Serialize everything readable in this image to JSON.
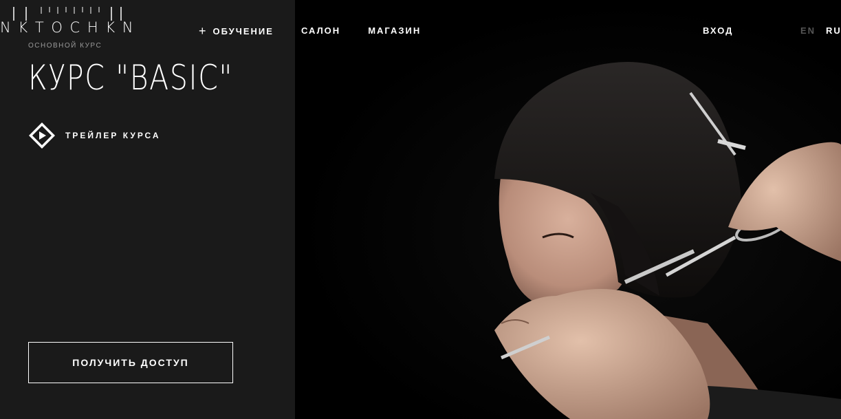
{
  "brand": {
    "logo_text": "N K T O C H K N",
    "logo_alt": "NIKITOCHKIN"
  },
  "course": {
    "subtitle": "ОСНОВНОЙ КУРС",
    "title": "КУРС \"BASIC\"",
    "trailer_label": "ТРЕЙЛЕР КУРСА",
    "cta_label": "ПОЛУЧИТЬ ДОСТУП"
  },
  "nav": {
    "items": [
      {
        "label": "ОБУЧЕНИЕ",
        "prefix": "+"
      },
      {
        "label": "САЛОН"
      },
      {
        "label": "МАГАЗИН"
      }
    ],
    "login": "ВХОД",
    "languages": [
      {
        "label": "EN",
        "active": false
      },
      {
        "label": "RU",
        "active": true
      }
    ]
  },
  "hero": {
    "image_description_icon": "haircut-photo"
  },
  "colors": {
    "left_panel": "#1a1a1a",
    "hero_bg": "#000000",
    "text": "#ffffff",
    "muted": "#9a9a9a",
    "inactive_lang": "#555555"
  }
}
